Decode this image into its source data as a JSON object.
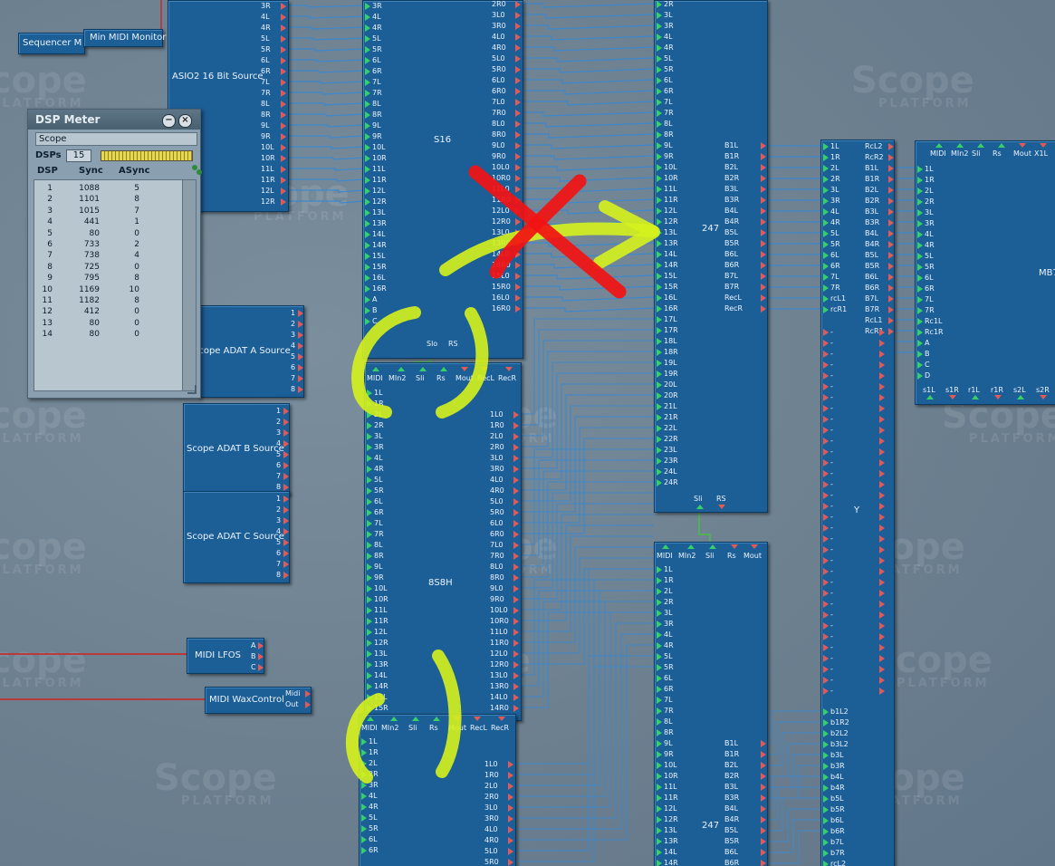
{
  "watermark": {
    "brand": "Scope",
    "sub": "PLATFORM"
  },
  "modules": {
    "sequencer": "Sequencer M",
    "midi_monitor": "Min MIDI Monitor",
    "asio_source": "ASIO2 16 Bit Source",
    "s16": "S16",
    "m247_top": "247",
    "m247_bottom": "247",
    "y": "Y",
    "mb_partial": "MB7",
    "adat_a": "Scope ADAT A Source",
    "adat_b": "Scope ADAT B Source",
    "adat_c": "Scope ADAT C Source",
    "midi_lfos": "MIDI LFOS",
    "midi_wax": "MIDI WaxControl",
    "mix8": "8S8H"
  },
  "asio_ports": [
    "3R",
    "4L",
    "4R",
    "5L",
    "5R",
    "6L",
    "6R",
    "7L",
    "7R",
    "8L",
    "8R",
    "9L",
    "9R",
    "10L",
    "10R",
    "11L",
    "11R",
    "12L",
    "12R"
  ],
  "s16_in_ports": [
    "3R",
    "4L",
    "4R",
    "5L",
    "5R",
    "6L",
    "6R",
    "7L",
    "7R",
    "8L",
    "8R",
    "9L",
    "9R",
    "10L",
    "10R",
    "11L",
    "11R",
    "12L",
    "12R",
    "13L",
    "13R",
    "14L",
    "14R",
    "15L",
    "15R",
    "16L",
    "16R",
    "A",
    "B",
    "C"
  ],
  "s16_out_ports": [
    "2R0",
    "3L0",
    "3R0",
    "4L0",
    "4R0",
    "5L0",
    "5R0",
    "6L0",
    "6R0",
    "7L0",
    "7R0",
    "8L0",
    "8R0",
    "9L0",
    "9R0",
    "10L0",
    "10R0",
    "11L0",
    "11R0",
    "12L0",
    "12R0",
    "13L0",
    "13R0",
    "14L0",
    "14R0",
    "15L0",
    "15R0",
    "16L0",
    "16R0"
  ],
  "m247_in_ports": [
    "2R",
    "3L",
    "3R",
    "4L",
    "4R",
    "5L",
    "5R",
    "6L",
    "6R",
    "7L",
    "7R",
    "8L",
    "8R",
    "9L",
    "9R",
    "10L",
    "10R",
    "11L",
    "11R",
    "12L",
    "12R",
    "13L",
    "13R",
    "14L",
    "14R",
    "15L",
    "15R",
    "16L",
    "16R",
    "17L",
    "17R",
    "18L",
    "18R",
    "19L",
    "19R",
    "20L",
    "20R",
    "21L",
    "21R",
    "22L",
    "22R",
    "23L",
    "23R",
    "24L",
    "24R"
  ],
  "m247_bottom_ports": [
    "1L",
    "1R",
    "2L",
    "2R",
    "3L",
    "3R",
    "4L",
    "4R",
    "5L",
    "5R",
    "6L",
    "6R",
    "7L",
    "7R",
    "8L",
    "8R",
    "9L",
    "9R",
    "10L",
    "10R",
    "11L",
    "11R",
    "12L",
    "12R",
    "13L",
    "13R",
    "14L",
    "14R"
  ],
  "b_ports": [
    "B1L",
    "B1R",
    "B2L",
    "B2R",
    "B3L",
    "B3R",
    "B4L",
    "B4R",
    "B5L",
    "B5R",
    "B6L",
    "B6R",
    "B7L",
    "B7R",
    "RecL",
    "RecR"
  ],
  "b_ports_bottom": [
    "B1L",
    "B1R",
    "B2L",
    "B2R",
    "B3L",
    "B3R",
    "B4L",
    "B4R",
    "B5L",
    "B5R",
    "B6L",
    "B6R"
  ],
  "y_in_ports": [
    "1L",
    "1R",
    "2L",
    "2R",
    "3L",
    "3R",
    "4L",
    "4R",
    "5L",
    "5R",
    "6L",
    "6R",
    "7L",
    "7R",
    "rcL1",
    "rcR1"
  ],
  "y_out_ports": [
    "RcL2",
    "RcR2",
    "B1L",
    "B1R",
    "B2L",
    "B2R",
    "B3L",
    "B3R",
    "B4L",
    "B4R",
    "B5L",
    "B5R",
    "B6L",
    "B6R",
    "B7L",
    "B7R",
    "RcL1",
    "RcR1"
  ],
  "y_bottom_ports": [
    "b1L2",
    "b1R2",
    "b2L2",
    "b3L2",
    "b3L",
    "b3R",
    "b4L",
    "b4R",
    "b5L",
    "b5R",
    "b6L",
    "b6R",
    "b7L",
    "b7R",
    "rcL2"
  ],
  "mb_in_ports": [
    "1L",
    "1R",
    "2L",
    "2R",
    "3L",
    "3R",
    "4L",
    "4R",
    "5L",
    "5R",
    "6L",
    "6R",
    "7L",
    "7R",
    "Rc1L",
    "Rc1R",
    "A",
    "B",
    "C",
    "D"
  ],
  "mb_top": [
    "MIDI",
    "MIn2",
    "Sli",
    "Rs",
    "Mout",
    "X1L"
  ],
  "mb_bottom": [
    "s1L",
    "s1R",
    "r1L",
    "r1R",
    "s2L",
    "s2R"
  ],
  "adat_ports": [
    "1",
    "2",
    "3",
    "4",
    "5",
    "6",
    "7",
    "8"
  ],
  "lfo_ports": [
    "A",
    "B",
    "C"
  ],
  "wax_ports": [
    "Midi",
    "Out"
  ],
  "mix_top": [
    "MIDI",
    "MIn2",
    "Sli",
    "Rs",
    "Mout",
    "RecL",
    "RecR"
  ],
  "mix_in_ports": [
    "1L",
    "1R",
    "2L",
    "2R",
    "3L",
    "3R",
    "4L",
    "4R",
    "5L",
    "5R",
    "6L",
    "6R",
    "7L",
    "7R",
    "8L",
    "8R",
    "9L",
    "9R",
    "10L",
    "10R",
    "11L",
    "11R",
    "12L",
    "12R",
    "13L",
    "13R",
    "14L",
    "14R",
    "15L",
    "15R"
  ],
  "mix_out_ports": [
    "1L0",
    "1R0",
    "2L0",
    "2R0",
    "3L0",
    "3R0",
    "4L0",
    "4R0",
    "5L0",
    "5R0",
    "6L0",
    "6R0",
    "7L0",
    "7R0",
    "8L0",
    "8R0",
    "9L0",
    "9R0",
    "10L0",
    "10R0",
    "11L0",
    "11R0",
    "12L0",
    "12R0",
    "13L0",
    "13R0",
    "14L0",
    "14R0"
  ],
  "mix2_top": [
    "MIDI",
    "MIn2",
    "Sli",
    "Rs",
    "Mout",
    "RecL",
    "RecR"
  ],
  "mix2_in_ports": [
    "1L",
    "1R",
    "2L",
    "2R",
    "3R",
    "4L",
    "4R",
    "5L",
    "5R",
    "6L",
    "6R"
  ],
  "mix2_out_ports": [
    "1L0",
    "1R0",
    "2L0",
    "2R0",
    "3L0",
    "3R0",
    "4L0",
    "4R0",
    "5L0",
    "5R0"
  ],
  "sli_rs": [
    "Sli",
    "RS"
  ],
  "m247_bottom_top": [
    "MIDI",
    "MIn2",
    "Sli",
    "Rs",
    "Mout"
  ],
  "dsp_meter": {
    "title": "DSP Meter",
    "name": "Scope",
    "dsps_label": "DSPs",
    "dsps_value": "15",
    "headers": [
      "DSP",
      "Sync",
      "ASync"
    ],
    "rows": [
      [
        "1",
        "1088",
        "5"
      ],
      [
        "2",
        "1101",
        "8"
      ],
      [
        "3",
        "1015",
        "7"
      ],
      [
        "4",
        "441",
        "1"
      ],
      [
        "5",
        "80",
        "0"
      ],
      [
        "6",
        "733",
        "2"
      ],
      [
        "7",
        "738",
        "4"
      ],
      [
        "8",
        "725",
        "0"
      ],
      [
        "9",
        "795",
        "8"
      ],
      [
        "10",
        "1169",
        "10"
      ],
      [
        "11",
        "1182",
        "8"
      ],
      [
        "12",
        "412",
        "0"
      ],
      [
        "13",
        "80",
        "0"
      ],
      [
        "14",
        "80",
        "0"
      ]
    ]
  },
  "colors": {
    "module": "#1c5e96",
    "wire": "#2a78c0",
    "pin_in": "#36d06a",
    "pin_out": "#e25a58",
    "highlight": "#d6f21c",
    "cross": "#f21212"
  }
}
